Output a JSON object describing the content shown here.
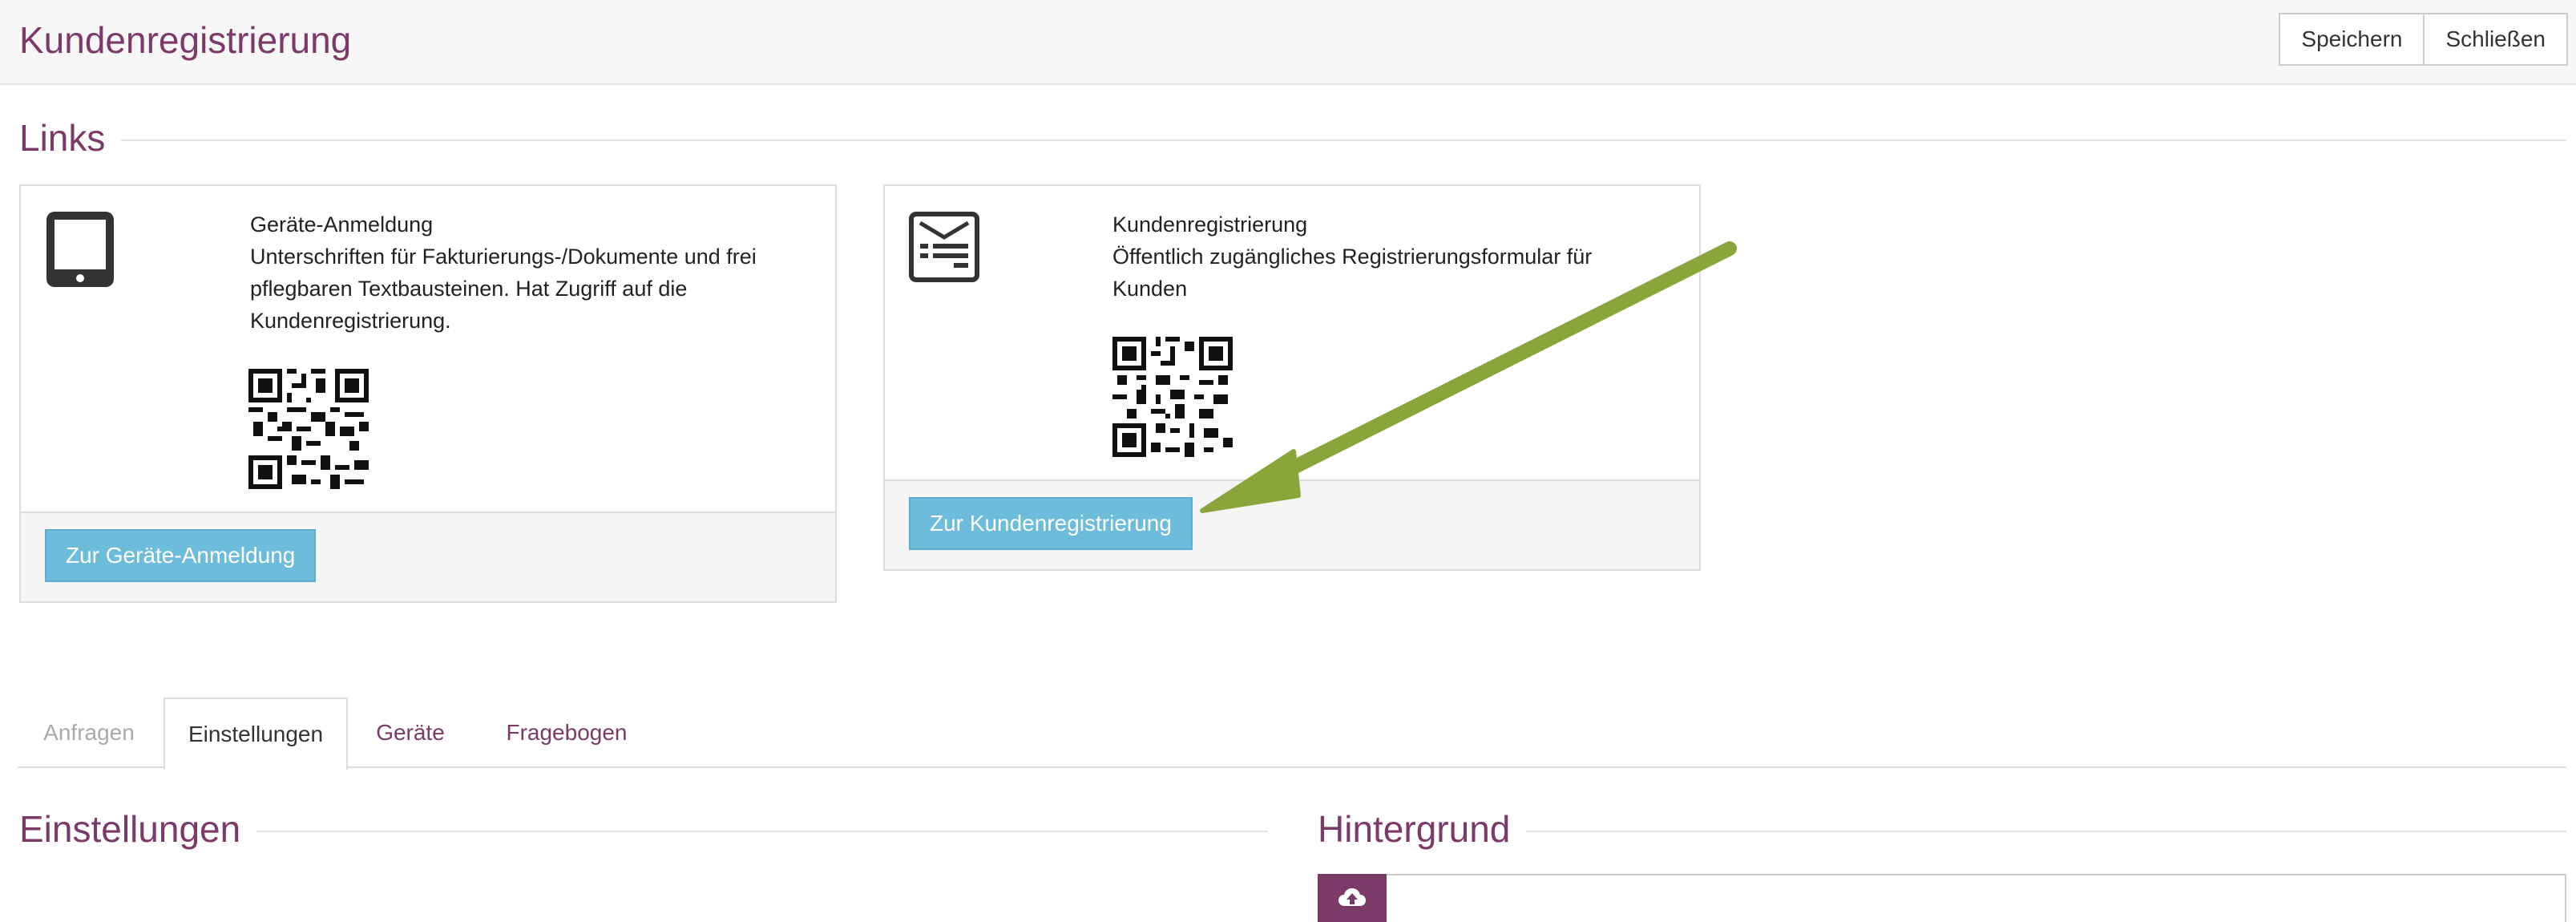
{
  "header": {
    "title": "Kundenregistrierung",
    "save_label": "Speichern",
    "close_label": "Schließen"
  },
  "links_section": {
    "title": "Links",
    "cards": [
      {
        "title": "Geräte-Anmeldung",
        "description_lines": [
          "Unterschriften für Fakturierungs-/Dokumente und frei",
          "pflegbaren Textbausteinen. Hat Zugriff auf die",
          "Kundenregistrierung."
        ],
        "button_label": "Zur Geräte-Anmeldung",
        "icon": "tablet-icon"
      },
      {
        "title": "Kundenregistrierung",
        "description_lines": [
          "Öffentlich zugängliches Registrierungsformular für",
          "Kunden"
        ],
        "button_label": "Zur Kundenregistrierung",
        "icon": "form-icon"
      }
    ]
  },
  "tabs": [
    {
      "label": "Anfragen",
      "state": "disabled"
    },
    {
      "label": "Einstellungen",
      "state": "active"
    },
    {
      "label": "Geräte",
      "state": "normal"
    },
    {
      "label": "Fragebogen",
      "state": "normal"
    }
  ],
  "settings_section": {
    "title": "Einstellungen"
  },
  "background_section": {
    "title": "Hintergrund",
    "upload_icon": "cloud-upload-icon"
  },
  "colors": {
    "brand": "#7b3a67",
    "button_blue": "#6dbcdb",
    "arrow_green": "#8aa63a",
    "tab_disabled": "#aaaaaa"
  }
}
